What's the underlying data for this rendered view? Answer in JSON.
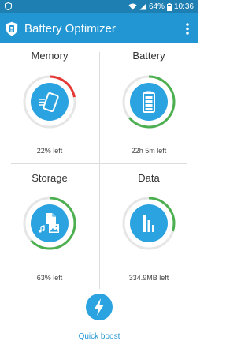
{
  "status_bar": {
    "battery_percent": "64%",
    "time": "10:36"
  },
  "app_bar": {
    "title": "Battery Optimizer",
    "menu_icon": "overflow-menu-icon"
  },
  "tiles": [
    {
      "title": "Memory",
      "caption": "22% left",
      "icon": "phone-clean-icon",
      "ring_level": 0.22,
      "ring_color": "#e53935"
    },
    {
      "title": "Battery",
      "caption": "22h 5m left",
      "icon": "battery-icon",
      "ring_level": 0.64,
      "ring_color": "#4caf50"
    },
    {
      "title": "Storage",
      "caption": "63% left",
      "icon": "files-icon",
      "ring_level": 0.63,
      "ring_color": "#4caf50"
    },
    {
      "title": "Data",
      "caption": "334.9MB left",
      "icon": "data-usage-icon",
      "ring_level": 0.3,
      "ring_color": "#4caf50"
    }
  ],
  "quick_boost": {
    "label": "Quick boost",
    "icon": "lightning-icon"
  },
  "colors": {
    "status_bar": "#1e80b2",
    "app_bar": "#2196d3",
    "accent": "#2aa3e0",
    "ring_track": "#e6e6e6"
  }
}
